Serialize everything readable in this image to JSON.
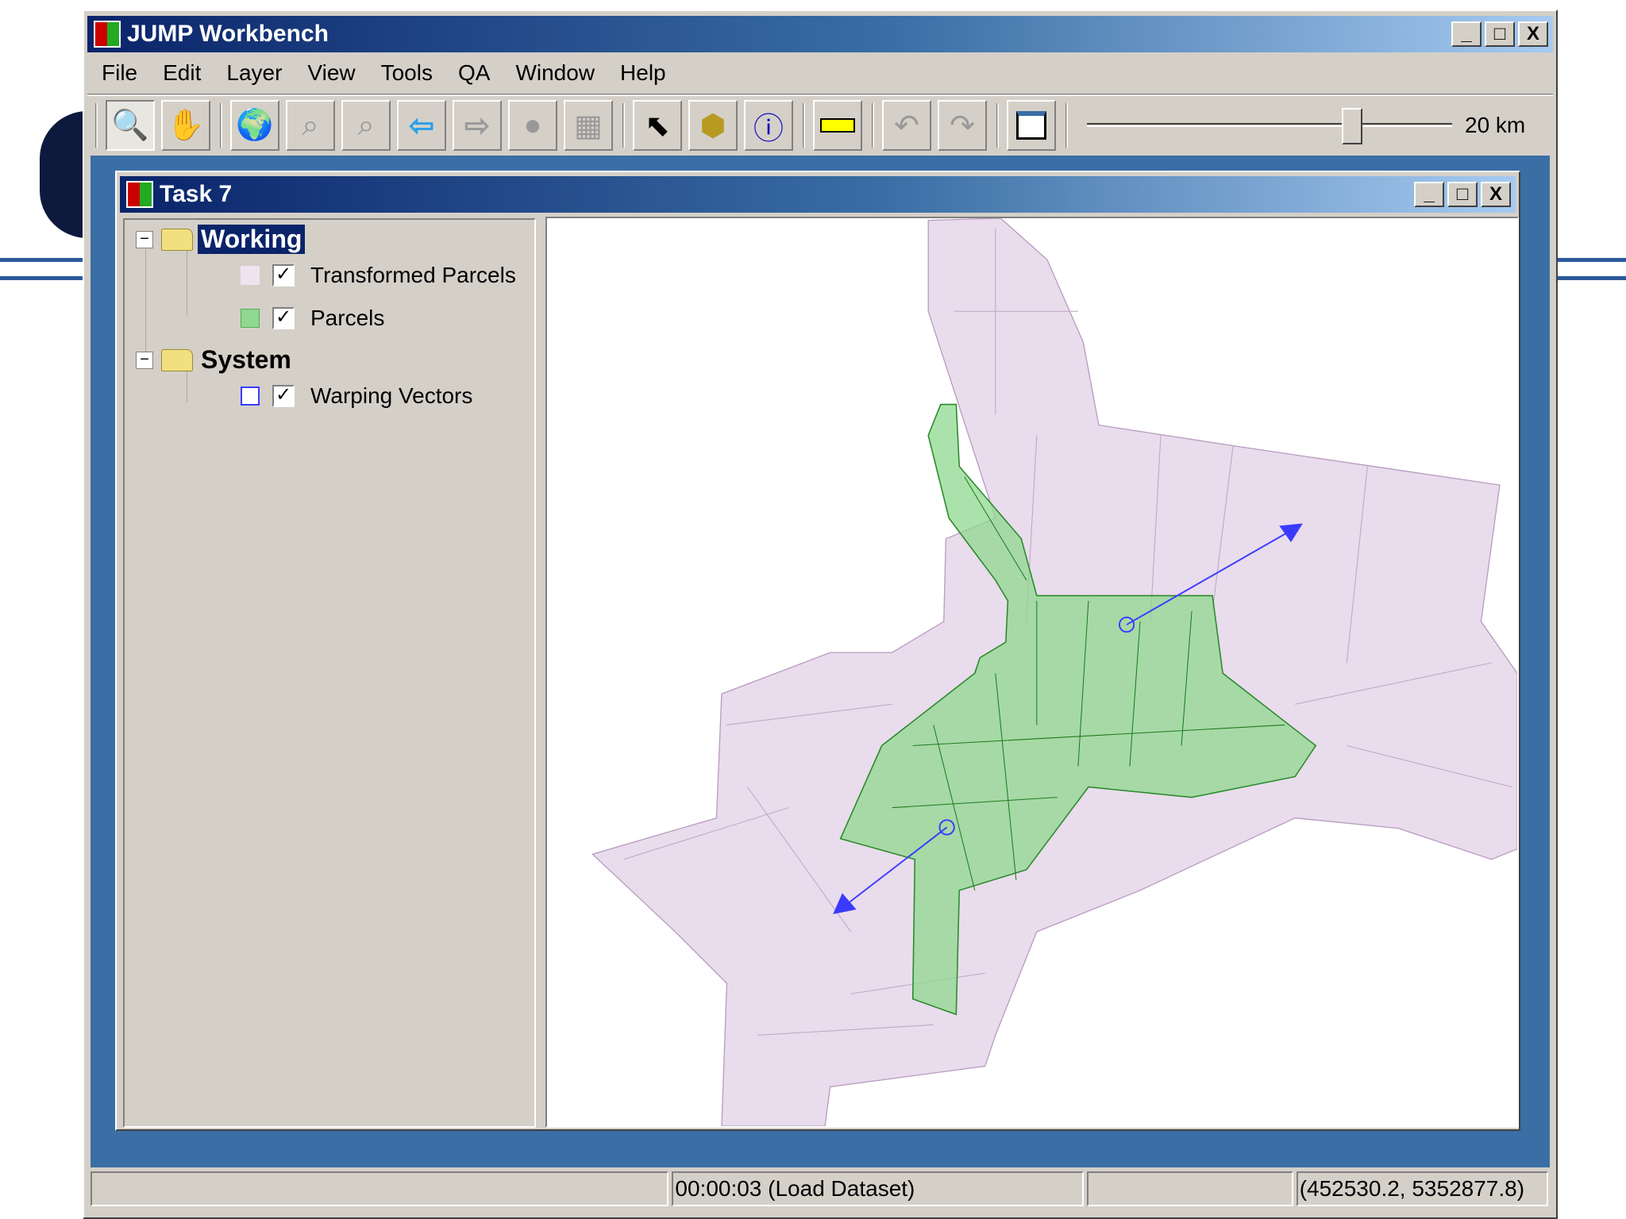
{
  "app": {
    "title": "JUMP Workbench",
    "window_controls": [
      "_",
      "□",
      "X"
    ]
  },
  "menu": [
    "File",
    "Edit",
    "Layer",
    "View",
    "Tools",
    "QA",
    "Window",
    "Help"
  ],
  "toolbar": {
    "buttons": [
      "zoom-icon",
      "pan-icon",
      "globe-icon",
      "zoom-previous-icon",
      "zoom-to-fence-icon",
      "back-arrow-icon",
      "forward-arrow-icon",
      "zoom-to-selected-icon",
      "grid-icon",
      "select-pointer-icon",
      "box-icon",
      "info-icon",
      "ruler-icon",
      "undo-icon",
      "redo-icon",
      "window-icon"
    ],
    "scale_label": "20 km",
    "scale_slider_fraction": 0.74
  },
  "task": {
    "title": "Task 7",
    "categories": [
      {
        "name": "Working",
        "selected": true,
        "layers": [
          {
            "name": "Transformed Parcels",
            "checked": true,
            "color": "#efe3f0"
          },
          {
            "name": "Parcels",
            "checked": true,
            "color": "#8fd88f"
          }
        ]
      },
      {
        "name": "System",
        "selected": false,
        "layers": [
          {
            "name": "Warping Vectors",
            "checked": true,
            "color": "#3b3bff"
          }
        ]
      }
    ]
  },
  "status": {
    "message": "",
    "timing": "00:00:03 (Load Dataset)",
    "extra": "",
    "coordinates": "(452530.2, 5352877.8)"
  },
  "colors": {
    "title_start": "#0a246a",
    "desktop": "#3a6ea5",
    "parcels_fill": "#8fd88f",
    "transformed_fill": "#e9dcec"
  }
}
